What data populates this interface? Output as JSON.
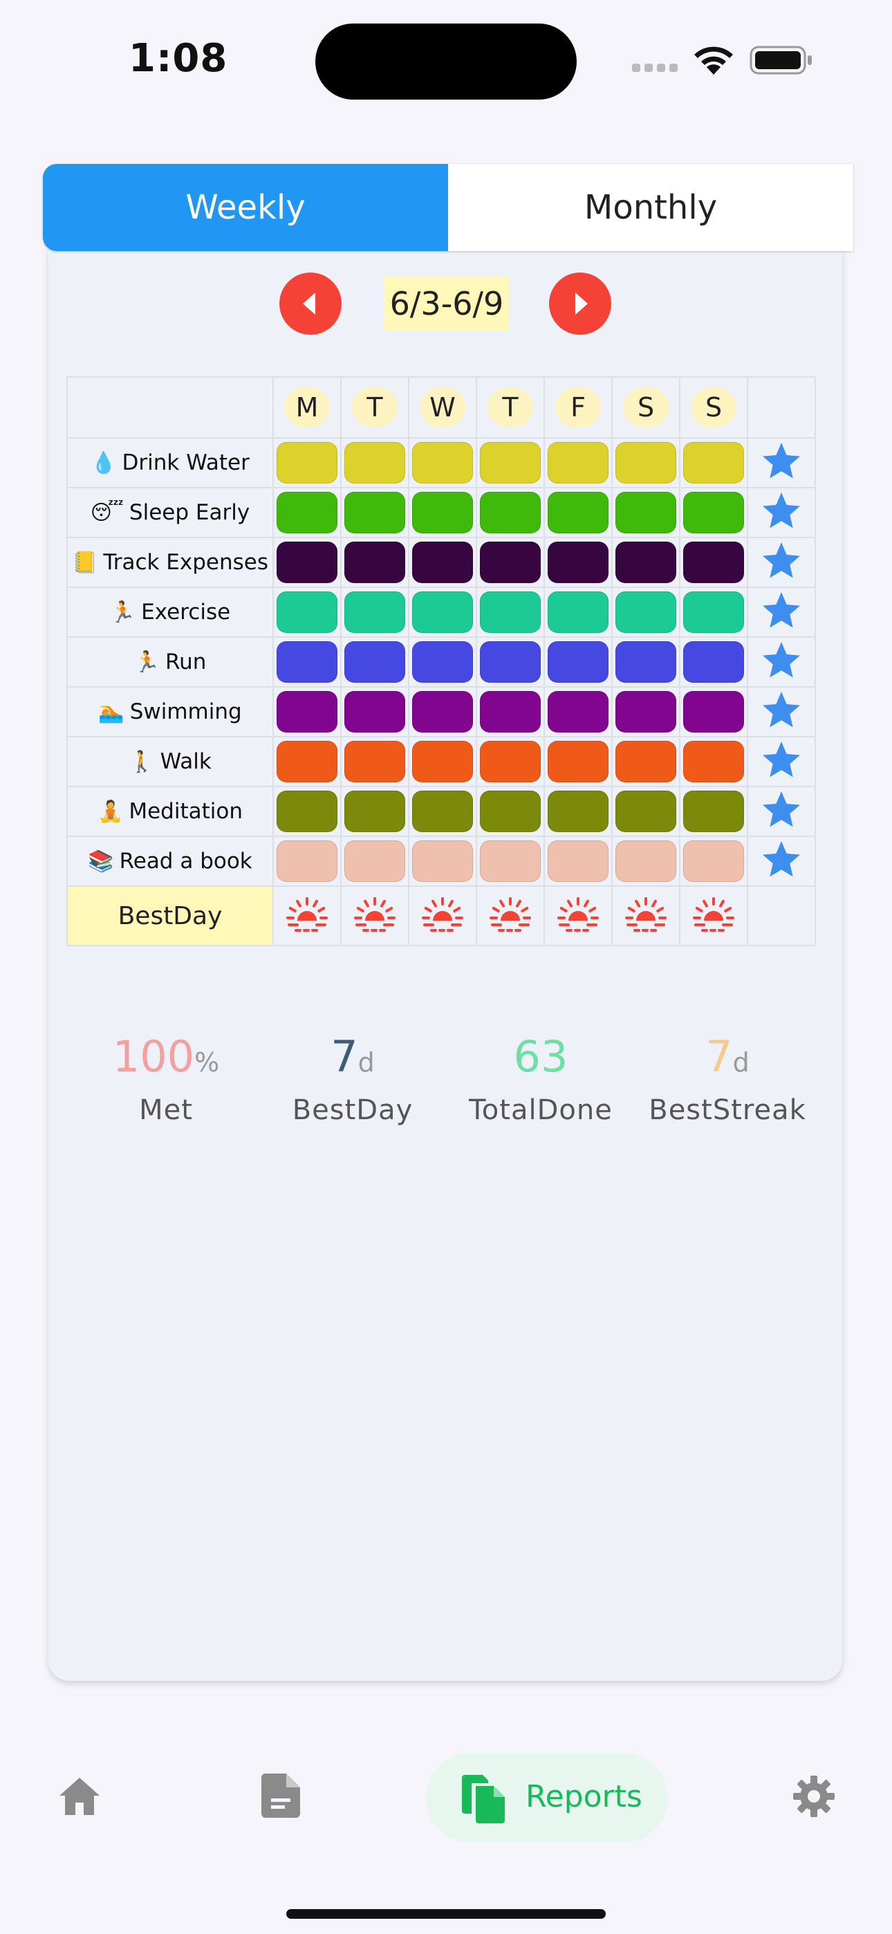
{
  "status_bar": {
    "time": "1:08"
  },
  "tabs": {
    "weekly": "Weekly",
    "monthly": "Monthly"
  },
  "week_nav": {
    "range": "6/3-6/9"
  },
  "grid": {
    "days": [
      "M",
      "T",
      "W",
      "T",
      "F",
      "S",
      "S"
    ],
    "habits": [
      {
        "name": "Drink Water",
        "icon": "droplet",
        "emoji": "💧",
        "color": "#ddd12c"
      },
      {
        "name": "Sleep Early",
        "icon": "sleeping-face",
        "emoji": "😴",
        "color": "#3fba0a"
      },
      {
        "name": "Track Expenses",
        "icon": "ledger",
        "emoji": "📒",
        "color": "#370640"
      },
      {
        "name": "Exercise",
        "icon": "runner",
        "emoji": "🏃",
        "color": "#1ccb93"
      },
      {
        "name": "Run",
        "icon": "runner",
        "emoji": "🏃",
        "color": "#4648e2"
      },
      {
        "name": "Swimming",
        "icon": "swimmer",
        "emoji": "🏊",
        "color": "#820590"
      },
      {
        "name": "Walk",
        "icon": "walker",
        "emoji": "🚶",
        "color": "#f05a18"
      },
      {
        "name": "Meditation",
        "icon": "lotus-position",
        "emoji": "🧘",
        "color": "#7b8a0a"
      },
      {
        "name": "Read a book",
        "icon": "books",
        "emoji": "📚",
        "color": "#f0c0ae"
      }
    ],
    "best_day_label": "BestDay",
    "star_color": "#3e8ef0",
    "sun_color": "#f44336"
  },
  "stats": [
    {
      "value": "100",
      "unit": "%",
      "label": "Met",
      "color": "#f2a0a2"
    },
    {
      "value": "7",
      "unit": "d",
      "label": "BestDay",
      "color": "#3c5d7a"
    },
    {
      "value": "63",
      "unit": "",
      "label": "TotalDone",
      "color": "#6fe0a3"
    },
    {
      "value": "7",
      "unit": "d",
      "label": "BestStreak",
      "color": "#f7c98f"
    }
  ],
  "bottom_nav": {
    "reports_label": "Reports"
  }
}
